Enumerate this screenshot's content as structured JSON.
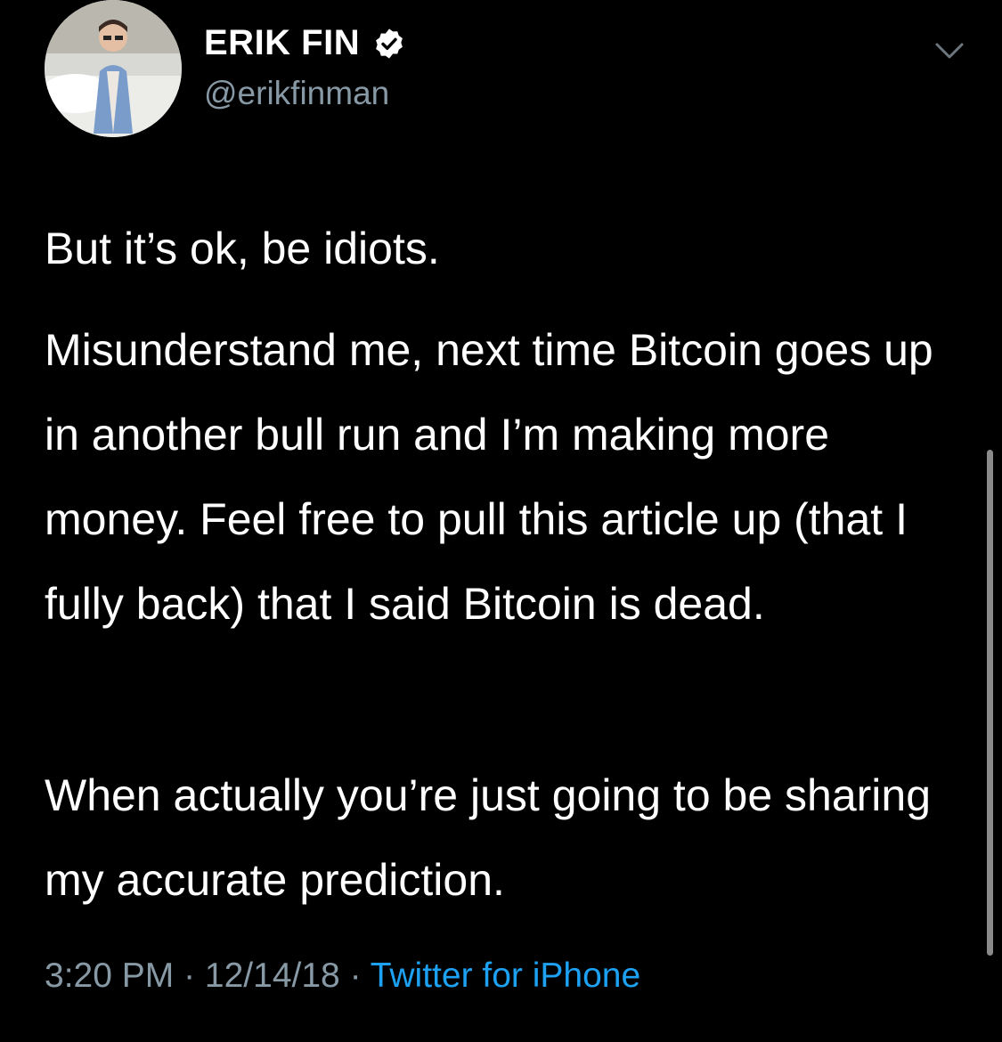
{
  "user": {
    "display_name": "ERIK FIN",
    "handle": "@erikfinman",
    "verified": true,
    "avatar_icon": "avatar-photo"
  },
  "tweet": {
    "paragraphs": [
      "But it’s ok, be idiots.",
      "Misunderstand me, next time Bitcoin goes up in another bull run and I’m making more money. Feel free to pull this article up (that I fully back) that I said Bitcoin is dead.",
      "When actually you’re just going to be sharing my accurate prediction."
    ]
  },
  "meta": {
    "time": "3:20 PM",
    "separator": " · ",
    "date": "12/14/18",
    "source": "Twitter for iPhone"
  },
  "icons": {
    "verified": "verified-badge-icon",
    "more": "chevron-down-icon"
  },
  "colors": {
    "background": "#000000",
    "text": "#ffffff",
    "secondary": "#8899a6",
    "link": "#1da1f2"
  }
}
